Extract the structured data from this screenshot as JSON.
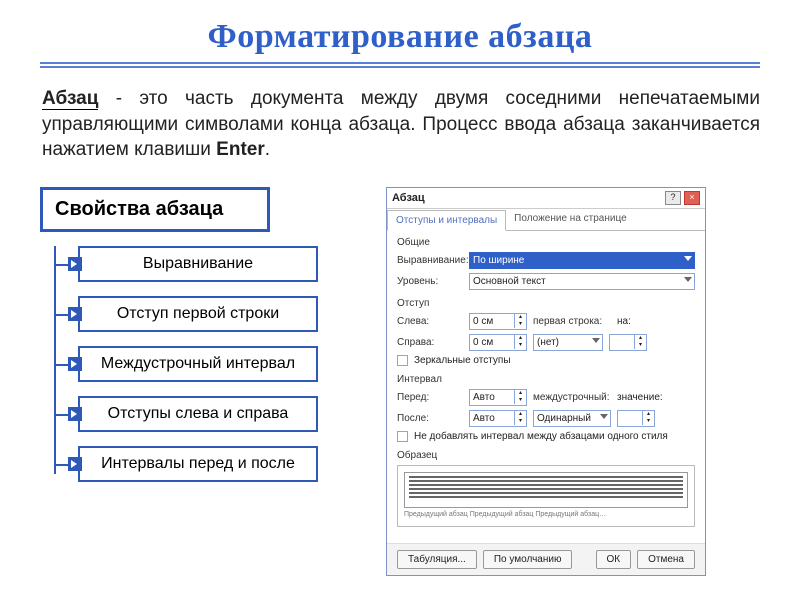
{
  "title": "Форматирование абзаца",
  "definition": {
    "term": "Абзац",
    "body": " - это часть документа между двумя соседними непечатаемыми управляющими символами конца абзаца. Процесс ввода абзаца заканчивается нажатием клавиши ",
    "enter": "Enter",
    "tail": "."
  },
  "properties_heading": "Свойства абзаца",
  "properties": [
    "Выравнивание",
    "Отступ первой строки",
    "Междустрочный интервал",
    "Отступы слева и справа",
    "Интервалы перед и после"
  ],
  "dialog": {
    "title": "Абзац",
    "tabs": {
      "active": "Отступы и интервалы",
      "second": "Положение на странице"
    },
    "group_general": "Общие",
    "align_label": "Выравнивание:",
    "align_value": "По ширине",
    "level_label": "Уровень:",
    "level_value": "Основной текст",
    "group_indent": "Отступ",
    "left_label": "Слева:",
    "left_value": "0 см",
    "firstline_label": "первая строка:",
    "firstline_on_label": "на:",
    "right_label": "Справа:",
    "right_value": "0 см",
    "firstline_value": "(нет)",
    "mirror_label": "Зеркальные отступы",
    "group_spacing": "Интервал",
    "before_label": "Перед:",
    "before_value": "Авто",
    "line_label": "междустрочный:",
    "line_val_label": "значение:",
    "after_label": "После:",
    "after_value": "Авто",
    "line_value": "Одинарный",
    "nostyle_label": "Не добавлять интервал между абзацами одного стиля",
    "preview_title": "Образец",
    "btn_tabs": "Табуляция...",
    "btn_default": "По умолчанию",
    "btn_ok": "ОК",
    "btn_cancel": "Отмена"
  }
}
